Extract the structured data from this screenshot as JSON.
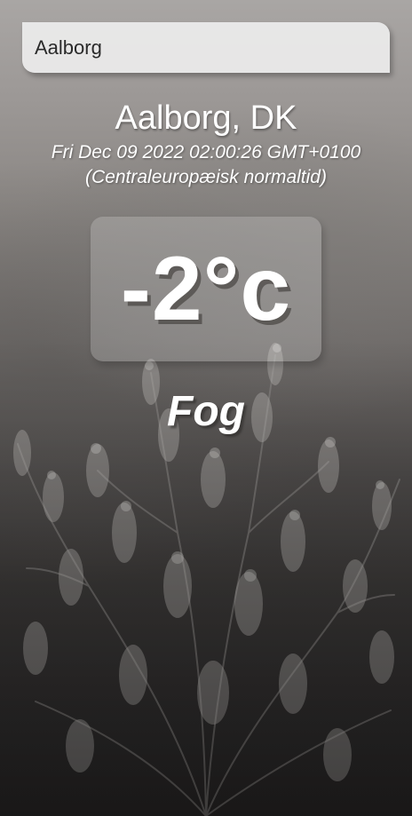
{
  "search": {
    "value": "Aalborg"
  },
  "location": {
    "label": "Aalborg, DK"
  },
  "date": {
    "text": "Fri Dec 09 2022 02:00:26 GMT+0100 (Centraleuropæisk normaltid)"
  },
  "temperature": {
    "display": "-2°c"
  },
  "weather": {
    "condition": "Fog"
  },
  "background": {
    "icon": "frosted-plants-photo"
  }
}
